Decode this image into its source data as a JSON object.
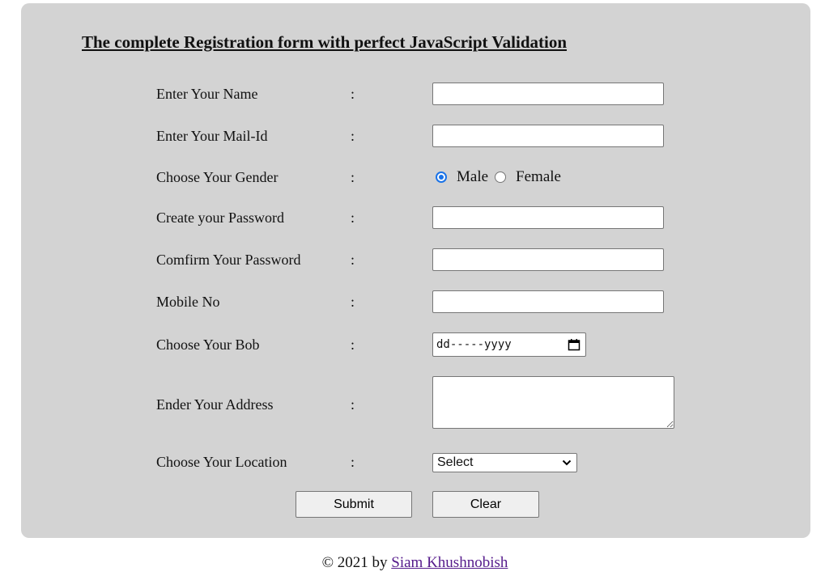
{
  "form": {
    "title": "The complete Registration form with perfect JavaScript Validation",
    "colon": ":",
    "fields": {
      "name": {
        "label": "Enter Your Name",
        "value": ""
      },
      "mail": {
        "label": "Enter Your Mail-Id",
        "value": ""
      },
      "gender": {
        "label": "Choose Your Gender",
        "options": [
          "Male",
          "Female"
        ],
        "selected": "Male"
      },
      "password": {
        "label": "Create your Password",
        "value": ""
      },
      "confirm_password": {
        "label": "Comfirm Your Password",
        "value": ""
      },
      "mobile": {
        "label": "Mobile No",
        "value": ""
      },
      "dob": {
        "label": "Choose Your Bob",
        "placeholder": "dd-----yyyy"
      },
      "address": {
        "label": "Ender Your Address",
        "value": ""
      },
      "location": {
        "label": "Choose Your Location",
        "selected": "Select"
      }
    },
    "buttons": {
      "submit": "Submit",
      "clear": "Clear"
    }
  },
  "footer": {
    "text": "© 2021 by",
    "link": "Siam Khushnobish"
  },
  "colors": {
    "panel_bg": "#d3d3d3",
    "radio_accent": "#1a73e8",
    "link": "#551a8b"
  }
}
